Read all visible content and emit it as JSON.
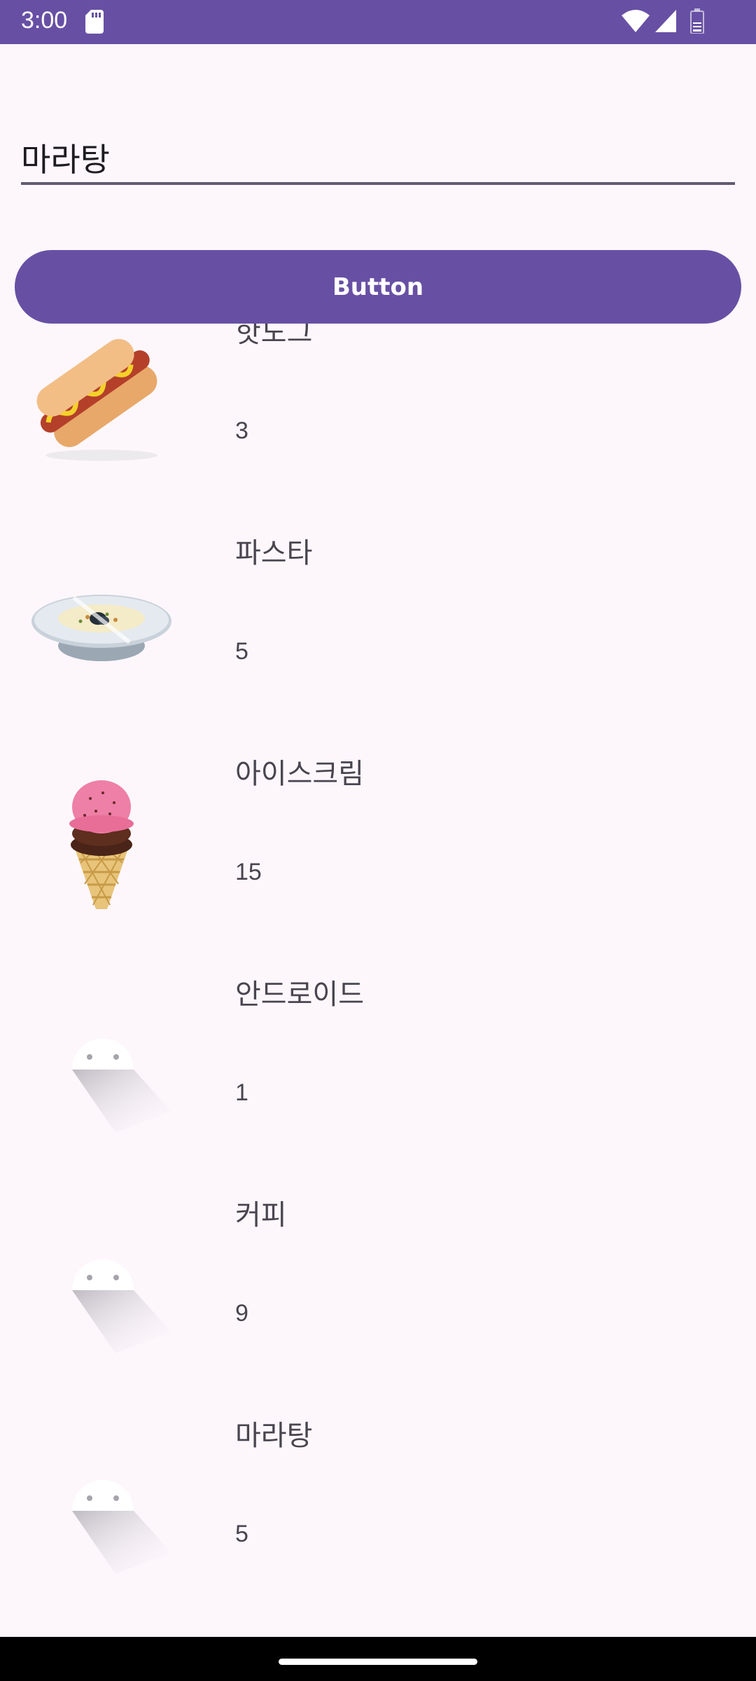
{
  "status_bar": {
    "time": "3:00"
  },
  "search": {
    "value": "마라탕"
  },
  "button": {
    "label": "Button"
  },
  "items": [
    {
      "name": "핫도그",
      "count": "3",
      "image": "hotdog-image"
    },
    {
      "name": "파스타",
      "count": "5",
      "image": "pasta-image"
    },
    {
      "name": "아이스크림",
      "count": "15",
      "image": "icecream-image"
    },
    {
      "name": "안드로이드",
      "count": "1",
      "image": "android-icon"
    },
    {
      "name": "커피",
      "count": "9",
      "image": "android-icon"
    },
    {
      "name": "마라탕",
      "count": "5",
      "image": "android-icon"
    }
  ],
  "colors": {
    "primary": "#6750A4",
    "background": "#FDF7FC",
    "underline": "#625B71",
    "secondary_text": "#49454F"
  }
}
